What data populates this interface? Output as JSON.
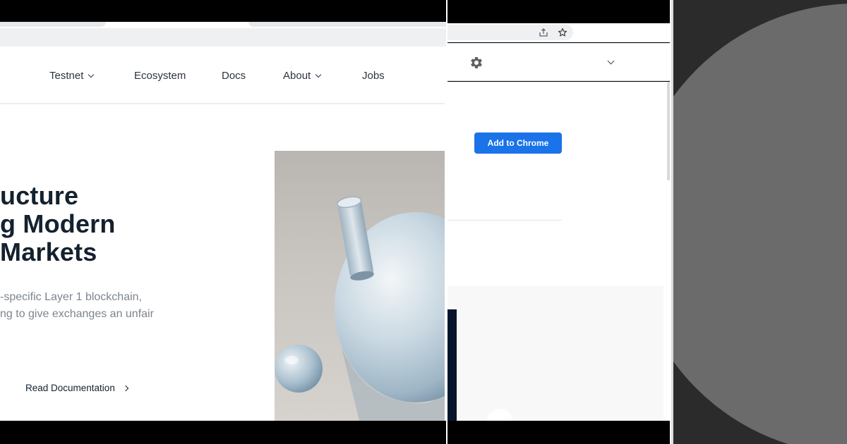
{
  "left_site": {
    "nav": {
      "testnet": "Testnet",
      "ecosystem": "Ecosystem",
      "docs": "Docs",
      "about": "About",
      "jobs": "Jobs"
    },
    "hero": {
      "title_lines": [
        "ucture",
        "g Modern",
        "Markets"
      ],
      "description_lines": [
        "-specific Layer 1 blockchain,",
        "ng to give exchanges an unfair"
      ],
      "cta_label": "Read Documentation"
    }
  },
  "chrome_store": {
    "add_button_label": "Add to Chrome"
  },
  "colors": {
    "accent_blue": "#1a73e8",
    "heading_dark": "#14212e",
    "muted_text": "#7d858e",
    "right_circle": "#6b6b6b",
    "right_bg": "#2b2b2b"
  },
  "icons": [
    "share-icon",
    "star-icon",
    "gear-icon",
    "chevron-down-icon",
    "chevron-right-icon"
  ]
}
